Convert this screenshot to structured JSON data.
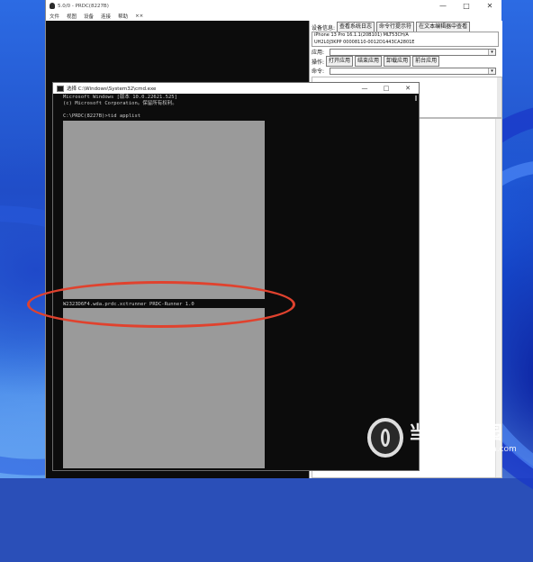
{
  "prdc": {
    "title": "5.0/0 - PRDC(8227B)",
    "menu": [
      "文件",
      "视图",
      "设备",
      "连接",
      "帮助",
      "××"
    ],
    "toolbar": {
      "device_info_label": "设备信息:",
      "buttons": [
        "查看系统日志",
        "命令行提示符",
        "在文本编辑器中查看"
      ]
    },
    "info_lines": [
      "iPhone 13 Pro 16.1.1(20B101) MLT53CH/A",
      "UH2L0J3KPP 00008110-0012D1443CA2801E"
    ],
    "app_label": "应用:",
    "app_value": "",
    "ops_label": "操作:",
    "op_buttons": [
      "打开应用",
      "结束应用",
      "卸载应用",
      "前台应用"
    ],
    "cmd_label": "命令:",
    "cmd_value": ""
  },
  "cmd": {
    "title": "选择 C:\\Windows\\System32\\cmd.exe",
    "caps": [
      "—",
      "□",
      "✕"
    ],
    "lines": [
      "Microsoft Windows [版本 10.0.22621.525]",
      "(c) Microsoft Corporation。保留所有权利。",
      "",
      "C:\\PRDC(8227B)>tid applist"
    ],
    "highlight_line": "W2323D6F4.wda.prdc.xctrunner PRDC-Runner 1.0"
  },
  "window_caps": [
    "—",
    "□",
    "✕"
  ],
  "watermark": {
    "brand": "当下软件园",
    "url": "www.downxia.com"
  },
  "colors": {
    "highlight": "#e0422e",
    "console_bg": "#0c0c0c",
    "redaction": "#9a9a9a"
  }
}
